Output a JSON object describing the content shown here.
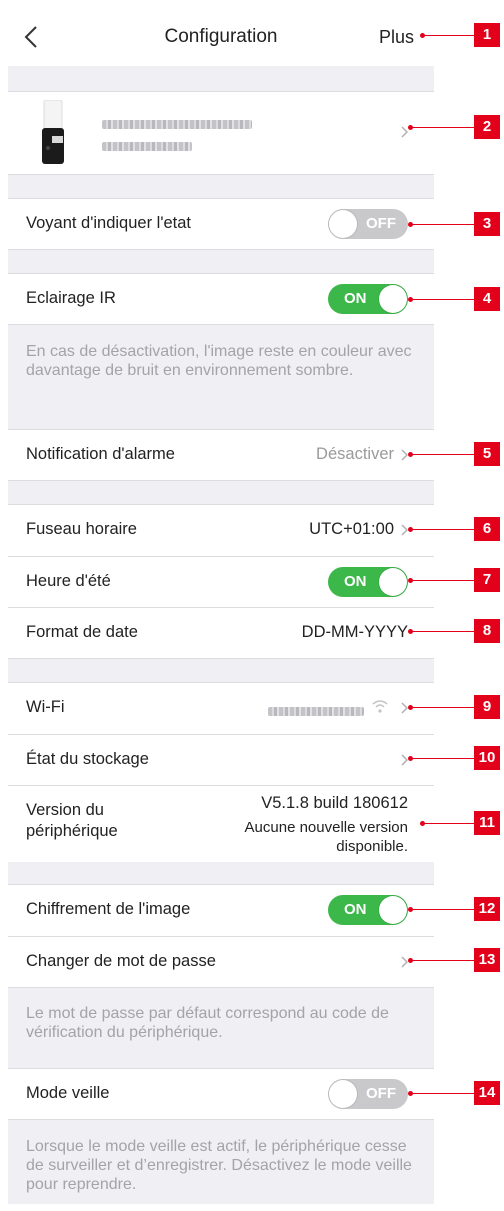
{
  "header": {
    "title": "Configuration",
    "action_label": "Plus"
  },
  "device": {
    "icon": "camera-light-icon"
  },
  "indicator": {
    "label": "Voyant d'indiquer l'etat",
    "toggle": "OFF"
  },
  "ir": {
    "label": "Eclairage IR",
    "toggle": "ON",
    "note": "En cas de désactivation, l'image reste en couleur avec davantage de bruit en environnement sombre."
  },
  "alarm": {
    "label": "Notification d'alarme",
    "value": "Désactiver"
  },
  "timezone": {
    "label": "Fuseau horaire",
    "value": "UTC+01:00"
  },
  "dst": {
    "label": "Heure d'été",
    "toggle": "ON"
  },
  "date_format": {
    "label": "Format de date",
    "value": "DD-MM-YYYY"
  },
  "wifi": {
    "label": "Wi-Fi"
  },
  "storage": {
    "label": "État du stockage"
  },
  "version": {
    "label_line1": "Version du",
    "label_line2": "périphérique",
    "number": "V5.1.8 build 180612",
    "status_line1": "Aucune nouvelle version",
    "status_line2": "disponible."
  },
  "encryption": {
    "label": "Chiffrement de l'image",
    "toggle": "ON"
  },
  "password": {
    "label": "Changer de mot de passe",
    "note": "Le mot de passe par défaut correspond au code de vérification du périphérique."
  },
  "sleep": {
    "label": "Mode veille",
    "toggle": "OFF",
    "note": "Lorsque le mode veille est actif, le périphérique cesse de surveiller et d’enregistrer. Désactivez le mode veille pour reprendre."
  },
  "callouts": [
    "1",
    "2",
    "3",
    "4",
    "5",
    "6",
    "7",
    "8",
    "9",
    "10",
    "11",
    "12",
    "13",
    "14"
  ],
  "colors": {
    "toggle_on": "#3cb84a",
    "toggle_off": "#c9c9cc",
    "callout": "#e3001b",
    "background": "#efeff4"
  }
}
